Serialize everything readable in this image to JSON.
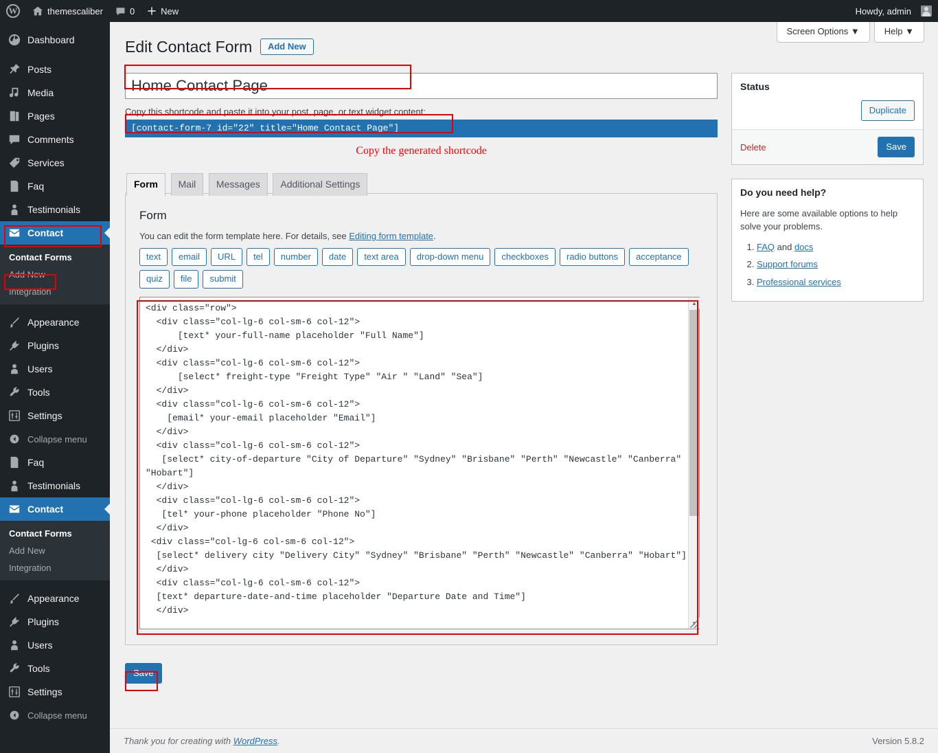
{
  "adminbar": {
    "logo_icon": "wordpress-logo-icon",
    "site_name": "themescaliber",
    "site_icon": "home-icon",
    "comments_icon": "comment-bubble-icon",
    "comments_count": "0",
    "new_icon": "plus-icon",
    "new_label": "New",
    "howdy": "Howdy, admin",
    "avatar_icon": "avatar-icon"
  },
  "sidebar": {
    "items": [
      {
        "label": "Dashboard",
        "icon": "dashboard-icon",
        "type": "top"
      },
      {
        "label": "Posts",
        "icon": "pin-icon",
        "type": "top"
      },
      {
        "label": "Media",
        "icon": "media-icon",
        "type": "top"
      },
      {
        "label": "Pages",
        "icon": "pages-icon",
        "type": "top"
      },
      {
        "label": "Comments",
        "icon": "comment-bubble-icon",
        "type": "top"
      },
      {
        "label": "Services",
        "icon": "tag-icon",
        "type": "top"
      },
      {
        "label": "Faq",
        "icon": "document-icon",
        "type": "top"
      },
      {
        "label": "Testimonials",
        "icon": "user-icon",
        "type": "top"
      },
      {
        "label": "Contact",
        "icon": "envelope-icon",
        "type": "top",
        "current": true
      }
    ],
    "submenu": {
      "heading": "Contact Forms",
      "items": [
        {
          "label": "Add New"
        },
        {
          "label": "Integration"
        }
      ]
    },
    "items2": [
      {
        "label": "Appearance",
        "icon": "brush-icon"
      },
      {
        "label": "Plugins",
        "icon": "plug-icon"
      },
      {
        "label": "Users",
        "icon": "users-icon"
      },
      {
        "label": "Tools",
        "icon": "wrench-icon"
      },
      {
        "label": "Settings",
        "icon": "sliders-icon"
      },
      {
        "label": "Collapse menu",
        "icon": "collapse-arrow-icon"
      }
    ],
    "items3": [
      {
        "label": "Faq",
        "icon": "document-icon"
      },
      {
        "label": "Testimonials",
        "icon": "user-icon"
      },
      {
        "label": "Contact",
        "icon": "envelope-icon",
        "current": true
      }
    ],
    "submenu2": {
      "heading": "Contact Forms",
      "items": [
        {
          "label": "Add New"
        },
        {
          "label": "Integration"
        }
      ]
    },
    "items4": [
      {
        "label": "Appearance",
        "icon": "brush-icon"
      },
      {
        "label": "Plugins",
        "icon": "plug-icon"
      },
      {
        "label": "Users",
        "icon": "users-icon"
      },
      {
        "label": "Tools",
        "icon": "wrench-icon"
      },
      {
        "label": "Settings",
        "icon": "sliders-icon"
      },
      {
        "label": "Collapse menu",
        "icon": "collapse-arrow-icon"
      }
    ]
  },
  "screen_meta": {
    "screen_options": "Screen Options",
    "help": "Help",
    "chevron": "▼"
  },
  "page": {
    "title": "Edit Contact Form",
    "add_new": "Add New",
    "form_title_value": "Home Contact Page",
    "shortcode_desc": "Copy this shortcode and paste it into your post, page, or text widget content:",
    "shortcode_value": "[contact-form-7 id=\"22\" title=\"Home Contact Page\"]",
    "annotation": "Copy the generated shortcode"
  },
  "tabs": [
    {
      "label": "Form",
      "active": true
    },
    {
      "label": "Mail",
      "active": false
    },
    {
      "label": "Messages",
      "active": false
    },
    {
      "label": "Additional Settings",
      "active": false
    }
  ],
  "form_panel": {
    "heading": "Form",
    "desc_prefix": "You can edit the form template here. For details, see ",
    "desc_link": "Editing form template",
    "desc_suffix": ".",
    "tag_buttons": [
      "text",
      "email",
      "URL",
      "tel",
      "number",
      "date",
      "text area",
      "drop-down menu",
      "checkboxes",
      "radio buttons",
      "acceptance",
      "quiz",
      "file",
      "submit"
    ],
    "code": "<div class=\"row\">\n  <div class=\"col-lg-6 col-sm-6 col-12\">\n      [text* your-full-name placeholder \"Full Name\"]\n  </div>\n  <div class=\"col-lg-6 col-sm-6 col-12\">\n      [select* freight-type \"Freight Type\" \"Air \" \"Land\" \"Sea\"]\n  </div>\n  <div class=\"col-lg-6 col-sm-6 col-12\">\n    [email* your-email placeholder \"Email\"]\n  </div>\n  <div class=\"col-lg-6 col-sm-6 col-12\">\n   [select* city-of-departure \"City of Departure\" \"Sydney\" \"Brisbane\" \"Perth\" \"Newcastle\" \"Canberra\" \"Hobart\"]\n  </div>\n  <div class=\"col-lg-6 col-sm-6 col-12\">\n   [tel* your-phone placeholder \"Phone No\"]\n  </div>\n <div class=\"col-lg-6 col-sm-6 col-12\">\n  [select* delivery city \"Delivery City\" \"Sydney\" \"Brisbane\" \"Perth\" \"Newcastle\" \"Canberra\" \"Hobart\"]\n  </div>\n  <div class=\"col-lg-6 col-sm-6 col-12\">\n  [text* departure-date-and-time placeholder \"Departure Date and Time\"]\n  </div>"
  },
  "save_label": "Save",
  "status_box": {
    "heading": "Status",
    "duplicate": "Duplicate",
    "delete": "Delete",
    "save": "Save"
  },
  "help_box": {
    "heading": "Do you need help?",
    "body": "Here are some available options to help solve your problems.",
    "items": [
      {
        "prefix": "",
        "link1": "FAQ",
        "mid": " and ",
        "link2": "docs"
      },
      {
        "prefix": "",
        "link1": "Support forums",
        "mid": "",
        "link2": ""
      },
      {
        "prefix": "",
        "link1": "Professional services",
        "mid": "",
        "link2": ""
      }
    ]
  },
  "footer": {
    "thanks_prefix": "Thank you for creating with ",
    "wordpress": "WordPress",
    "thanks_suffix": ".",
    "version": "Version 5.8.2"
  },
  "colors": {
    "admin_dark": "#1d2327",
    "admin_submenu": "#2c3338",
    "accent_blue": "#2271b1",
    "annotation_red": "#e60000",
    "delete_red": "#b32d2e"
  }
}
